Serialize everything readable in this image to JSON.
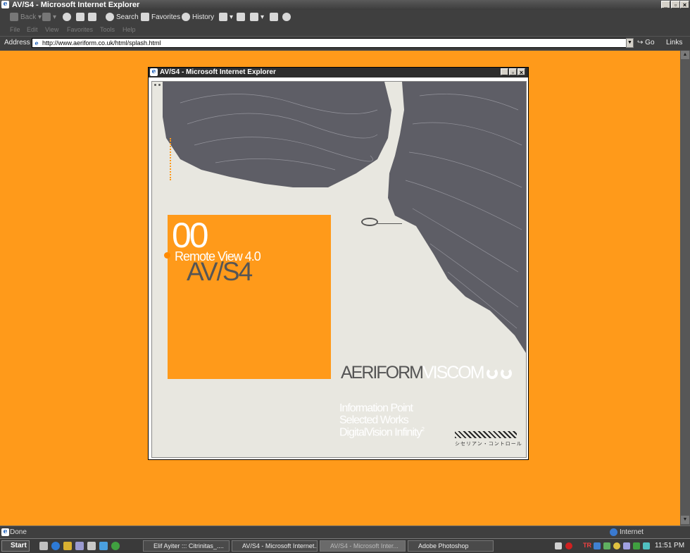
{
  "window": {
    "title": "AV/S4 - Microsoft Internet Explorer"
  },
  "toolbar": {
    "back": "Back",
    "search": "Search",
    "favorites": "Favorites",
    "history": "History"
  },
  "menu": [
    "File",
    "Edit",
    "View",
    "Favorites",
    "Tools",
    "Help"
  ],
  "address": {
    "label": "Address",
    "url": "http://www.aeriform.co.uk/html/splash.html",
    "go": "Go",
    "links": "Links"
  },
  "popup": {
    "title": "AV/S4 - Microsoft Internet Explorer",
    "number": "00",
    "remote_view": "Remote View 4.0",
    "avs4": "AV/S4",
    "brand_part1": "AERIFORM",
    "brand_part2": "VISCOM",
    "info_lines": [
      "Information Point",
      "Selected Works",
      "DigitalVision Infinity"
    ],
    "superscript": "2",
    "japanese": "シセリアン・コントロール"
  },
  "status": {
    "text": "Done",
    "zone": "Internet"
  },
  "taskbar": {
    "start": "Start",
    "tasks": [
      {
        "label": "Elif Ayiter ::: Citrinitas_....",
        "active": false
      },
      {
        "label": "AV/S4 - Microsoft Internet...",
        "active": false
      },
      {
        "label": "AV/S4 - Microsoft Inter...",
        "active": true
      },
      {
        "label": "Adobe Photoshop",
        "active": false
      }
    ],
    "lang": "TR",
    "clock": "11:51 PM"
  },
  "colors": {
    "page_bg": "#ff9a1a",
    "terrain": "#5e5e66",
    "popup_bg": "#e8e7e0"
  }
}
